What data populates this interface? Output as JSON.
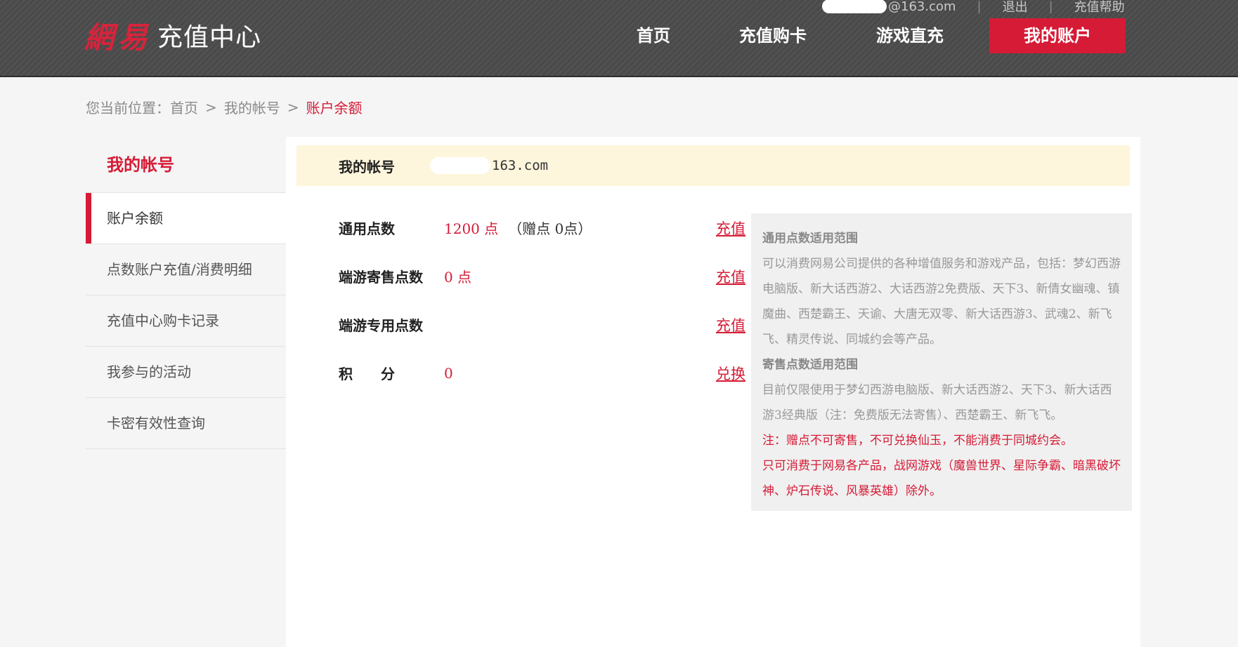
{
  "header": {
    "logo_brand": "網易",
    "logo_sub": "充值中心",
    "user_email_suffix": "@163.com",
    "logout_label": "退出",
    "help_label": "充值帮助",
    "nav": {
      "home": "首页",
      "buy_card": "充值购卡",
      "game_recharge": "游戏直充",
      "my_account": "我的账户"
    }
  },
  "breadcrumb": {
    "prefix": "您当前位置：",
    "home": "首页",
    "my_account": "我的帐号",
    "current": "账户余额",
    "separator": ">"
  },
  "sidebar": {
    "title": "我的帐号",
    "items": [
      {
        "label": "账户余额",
        "active": true
      },
      {
        "label": "点数账户充值/消费明细",
        "active": false
      },
      {
        "label": "充值中心购卡记录",
        "active": false
      },
      {
        "label": "我参与的活动",
        "active": false
      },
      {
        "label": "卡密有效性查询",
        "active": false
      }
    ]
  },
  "account": {
    "label": "我的帐号",
    "value_suffix": "163.com"
  },
  "balances": [
    {
      "label": "通用点数",
      "value": "1200 点",
      "extra": "（赠点 0点）",
      "action": "充值"
    },
    {
      "label": "端游寄售点数",
      "value": "0 点",
      "extra": "",
      "action": "充值"
    },
    {
      "label": "端游专用点数",
      "value": "",
      "extra": "",
      "action": "充值"
    },
    {
      "label": "积　　分",
      "value": "0",
      "extra": "",
      "action": "兑换"
    }
  ],
  "info": {
    "heading1": "通用点数适用范围",
    "text1": "可以消费网易公司提供的各种增值服务和游戏产品，包括：梦幻西游电脑版、新大话西游2、大话西游2免费版、天下3、新倩女幽魂、镇魔曲、西楚霸王、天谕、大唐无双零、新大话西游3、武魂2、新飞飞、精灵传说、同城约会等产品。",
    "heading2": "寄售点数适用范围",
    "text2": "目前仅限使用于梦幻西游电脑版、新大话西游2、天下3、新大话西游3经典版（注：免费版无法寄售）、西楚霸王、新飞飞。",
    "note1": "注：赠点不可寄售，不可兑换仙玉，不能消费于同城约会。",
    "note2": "只可消费于网易各产品，战网游戏（魔兽世界、星际争霸、暗黑破坏神、炉石传说、风暴英雄）除外。"
  },
  "colors": {
    "accent": "#d51b36",
    "header_bg": "#4a4a4a",
    "account_bar_bg": "#fdf6dc",
    "info_bg": "#f0f0f0"
  }
}
